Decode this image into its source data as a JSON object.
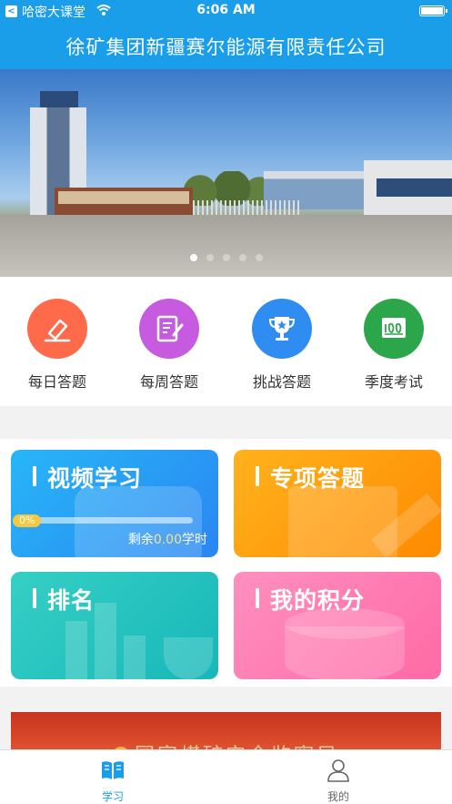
{
  "status_bar": {
    "back_glyph": "<",
    "carrier": "哈密大课堂",
    "time": "6:06 AM",
    "wifi_icon": "wifi-icon",
    "battery_icon": "battery-icon"
  },
  "header": {
    "title": "徐矿集团新疆赛尔能源有限责任公司"
  },
  "banner": {
    "slide_count": 5,
    "active_slide": 1
  },
  "quick_menu": [
    {
      "label": "每日答题",
      "icon": "pencil-eraser-icon",
      "color": "#ff6b4a"
    },
    {
      "label": "每周答题",
      "icon": "notepad-pen-icon",
      "color": "#c75be0"
    },
    {
      "label": "挑战答题",
      "icon": "trophy-icon",
      "color": "#2f8cf0"
    },
    {
      "label": "季度考试",
      "icon": "score-100-icon",
      "color": "#2ca64a"
    }
  ],
  "cards": {
    "video": {
      "title": "视频学习",
      "progress_text": "0%",
      "progress": 0,
      "remain_prefix": "剩余",
      "remain_value": "0.00",
      "remain_unit": "学时"
    },
    "special": {
      "title": "专项答题"
    },
    "ranking": {
      "title": "排名"
    },
    "points": {
      "title": "我的积分"
    }
  },
  "bottom_banner": {
    "text": "国家煤矿安全监察局"
  },
  "tabbar": {
    "items": [
      {
        "label": "学习",
        "icon": "book-icon",
        "active": true
      },
      {
        "label": "我的",
        "icon": "user-icon",
        "active": false
      }
    ],
    "active_color": "#1a9eea",
    "inactive_color": "#666666"
  }
}
